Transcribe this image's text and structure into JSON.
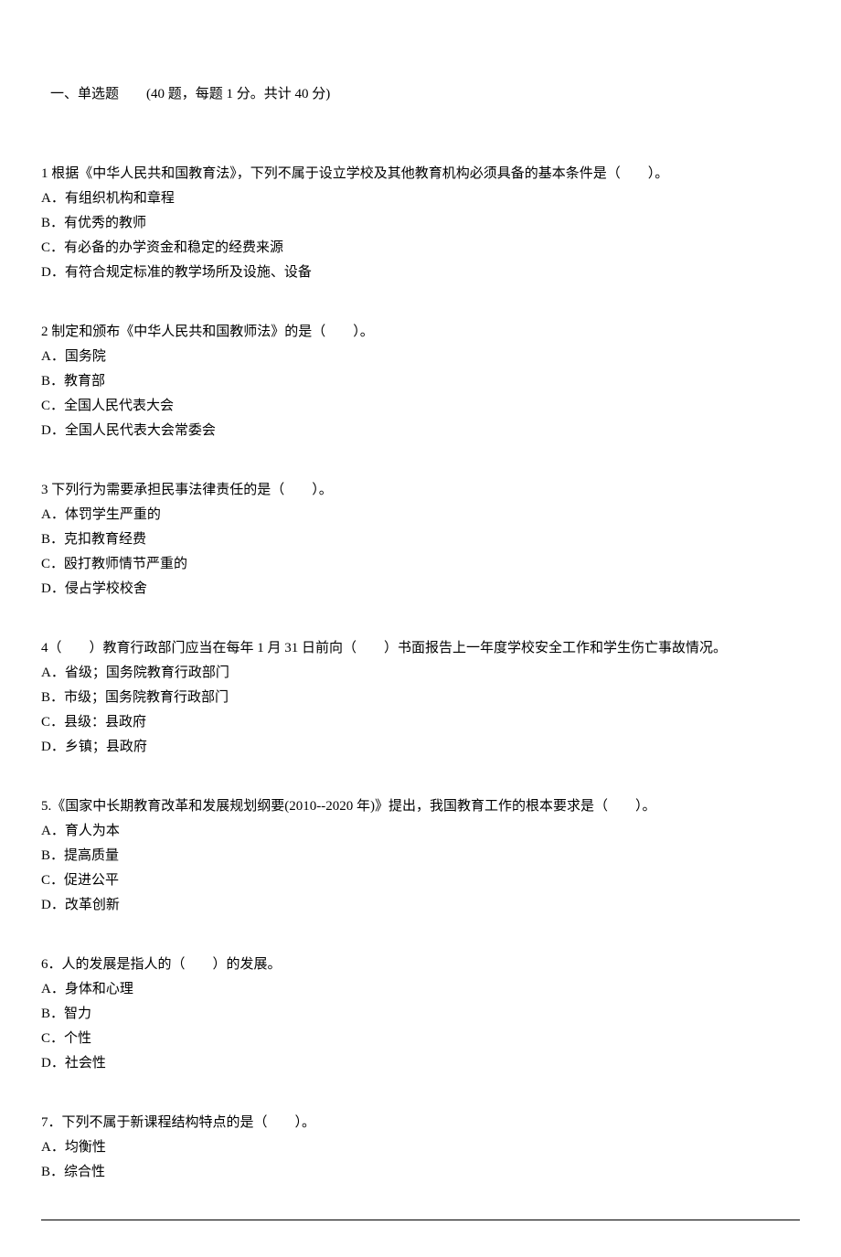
{
  "section_title": "一、单选题　　(40 题，每题 1 分。共计 40 分)",
  "questions": [
    {
      "stem": "1 根据《中华人民共和国教育法》，下列不属于设立学校及其他教育机构必须具备的基本条件是（　　）。",
      "options": [
        "A．有组织机构和章程",
        "B．有优秀的教师",
        "C．有必备的办学资金和稳定的经费来源",
        "D．有符合规定标准的教学场所及设施、设备"
      ]
    },
    {
      "stem": "2 制定和颁布《中华人民共和国教师法》的是（　　）。",
      "options": [
        "A．国务院",
        "B．教育部",
        "C．全国人民代表大会",
        "D．全国人民代表大会常委会"
      ]
    },
    {
      "stem": "3 下列行为需要承担民事法律责任的是（　　）。",
      "options": [
        "A．体罚学生严重的",
        "B．克扣教育经费",
        "C．殴打教师情节严重的",
        "D．侵占学校校舍"
      ]
    },
    {
      "stem": "4（　　）教育行政部门应当在每年 1 月 31 日前向（　　）书面报告上一年度学校安全工作和学生伤亡事故情况。",
      "options": [
        "A．省级；国务院教育行政部门",
        "B．市级；国务院教育行政部门",
        "C．县级：县政府",
        "D．乡镇；县政府"
      ]
    },
    {
      "stem": "5.《国家中长期教育改革和发展规划纲要(2010--2020 年)》提出，我国教育工作的根本要求是（　　）。",
      "options": [
        "A．育人为本",
        "B．提高质量",
        "C．促进公平",
        "D．改革创新"
      ]
    },
    {
      "stem": "6．人的发展是指人的（　　）的发展。",
      "options": [
        "A．身体和心理",
        "B．智力",
        "C．个性",
        "D．社会性"
      ]
    },
    {
      "stem": "7．下列不属于新课程结构特点的是（　　）。",
      "options": [
        "A．均衡性",
        "B．综合性"
      ]
    }
  ]
}
